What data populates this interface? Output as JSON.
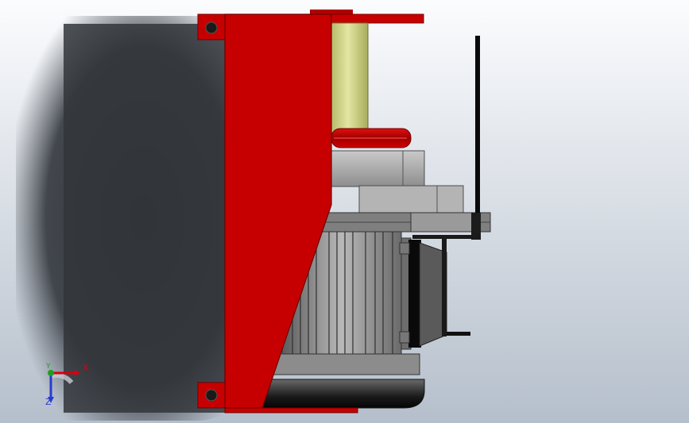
{
  "viewport": {
    "background_top": "#fbfcfe",
    "background_bottom": "#b5bfcb"
  },
  "colors": {
    "frame_red": "#c60000",
    "spool_yellow": "#d4d88c",
    "motor_gray": "#a3a3a3",
    "black_part": "#0a0a0a"
  },
  "triad": {
    "x_label": "X",
    "y_label": "Y",
    "z_label": "Z"
  }
}
